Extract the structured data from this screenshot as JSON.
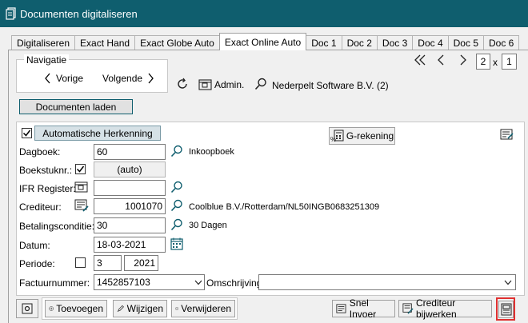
{
  "window": {
    "title": "Documenten digitaliseren"
  },
  "tabs": [
    {
      "label": "Digitaliseren"
    },
    {
      "label": "Exact Hand"
    },
    {
      "label": "Exact Globe Auto"
    },
    {
      "label": "Exact Online Auto",
      "active": true
    },
    {
      "label": "Doc 1"
    },
    {
      "label": "Doc 2"
    },
    {
      "label": "Doc 3"
    },
    {
      "label": "Doc 4"
    },
    {
      "label": "Doc 5"
    },
    {
      "label": "Doc 6"
    }
  ],
  "navigation": {
    "legend": "Navigatie",
    "prev_label": "Vorige",
    "next_label": "Volgende",
    "admin_label": "Admin.",
    "admin_name": "Nederpelt Software B.V. (2)",
    "page_current": "2",
    "page_sep": "x",
    "page_total": "1"
  },
  "load_button": "Documenten laden",
  "recognition": {
    "auto_button": "Automatische Herkenning",
    "auto_checked": true,
    "grekening_label": "G-rekening"
  },
  "form": {
    "dagboek": {
      "label": "Dagboek:",
      "value": "60",
      "desc": "Inkoopboek"
    },
    "boekstuk": {
      "label": "Boekstuknr.:",
      "checked": true,
      "value": "(auto)"
    },
    "ifr": {
      "label": "IFR Register:",
      "value": ""
    },
    "crediteur": {
      "label": "Crediteur:",
      "value": "1001070",
      "desc": "Coolblue B.V./Rotterdam/NL50INGB0683251309"
    },
    "betaling": {
      "label": "Betalingsconditie:",
      "value": "30",
      "desc": "30 Dagen"
    },
    "datum": {
      "label": "Datum:",
      "value": "18-03-2021"
    },
    "periode": {
      "label": "Periode:",
      "checked": false,
      "period": "3",
      "year": "2021"
    },
    "factuur": {
      "label": "Factuurnummer:",
      "value": "1452857103"
    },
    "omschrijving": {
      "label": "Omschrijving:",
      "value": ""
    }
  },
  "bottom": {
    "add_label": "Toevoegen",
    "edit_label": "Wijzigen",
    "delete_label": "Verwijderen",
    "quick_label": "Snel Invoer",
    "creditor_update_label": "Crediteur bijwerken"
  },
  "colors": {
    "titlebar": "#0f5e6e",
    "accent": "#0f5e6e",
    "highlight": "#e03030"
  }
}
